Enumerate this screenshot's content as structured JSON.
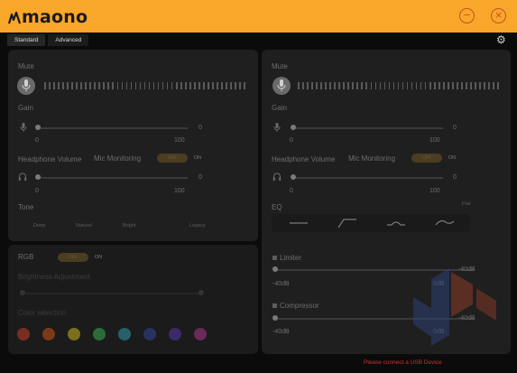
{
  "app": {
    "logo_text": "maono"
  },
  "tabs": [
    {
      "label": "Standard"
    },
    {
      "label": "Advanced"
    }
  ],
  "channels": [
    {
      "mute_label": "Mute",
      "gain": {
        "label": "Gain",
        "min": "0",
        "max": "100",
        "value": "0"
      },
      "headphone": {
        "label": "Headphone Volume",
        "min": "0",
        "max": "100",
        "value": "0"
      },
      "monitoring": {
        "label": "Mic Monitoring",
        "off": "OFF",
        "on": "ON"
      }
    },
    {
      "mute_label": "Mute",
      "gain": {
        "label": "Gain",
        "min": "0",
        "max": "100",
        "value": "0"
      },
      "headphone": {
        "label": "Headphone Volume",
        "min": "0",
        "max": "100",
        "value": "0"
      },
      "monitoring": {
        "label": "Mic Monitoring",
        "off": "OFF",
        "on": "ON"
      }
    }
  ],
  "tone": {
    "label": "Tone",
    "options": [
      "Deep",
      "Natural",
      "Bright",
      "Legacy"
    ]
  },
  "eq": {
    "label": "EQ",
    "preset": "Flat"
  },
  "limiter": {
    "label": "Limiter",
    "min": "-40dB",
    "max": "-40dB",
    "value": "0dB"
  },
  "compressor": {
    "label": "Compressor",
    "min": "-40dB",
    "max": "-40dB",
    "value": "0dB"
  },
  "rgb": {
    "label": "RGB",
    "off": "OFF",
    "on": "ON",
    "brightness_label": "Brightness Adjustment",
    "color_label": "Color selection",
    "colors": [
      "#7a2d22",
      "#7a3a18",
      "#7a6f1c",
      "#2d6a3a",
      "#26616a",
      "#28315f",
      "#3a2a6a",
      "#6a2a5a"
    ]
  },
  "status": {
    "text": "Please connect a USB Device"
  },
  "colors": {
    "accent": "#f9a72b",
    "background": "#0b0b0b",
    "panel": "#1f1f1f",
    "error": "#d03030"
  }
}
